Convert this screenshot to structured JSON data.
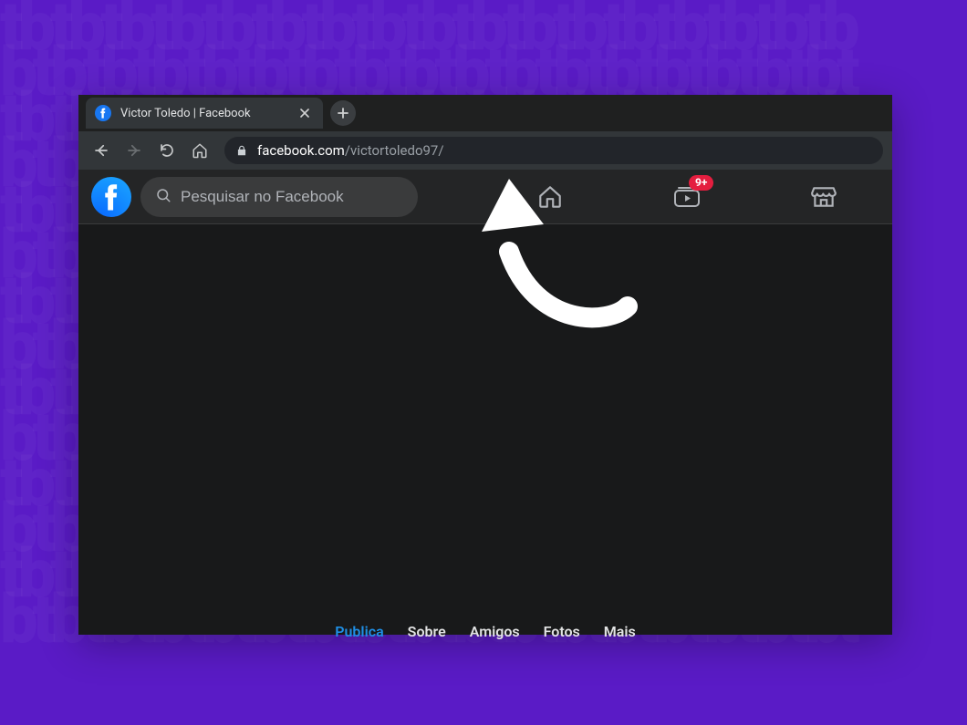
{
  "browser": {
    "tab_title": "Victor Toledo | Facebook",
    "url_domain": "facebook.com",
    "url_path": "/victortoledo97/"
  },
  "facebook": {
    "search_placeholder": "Pesquisar no Facebook",
    "watch_badge": "9+",
    "bottom_links": {
      "publicacoes": "Publica",
      "sobre": "Sobre",
      "amigos": "Amigos",
      "fotos": "Fotos",
      "mais": "Mais"
    }
  }
}
